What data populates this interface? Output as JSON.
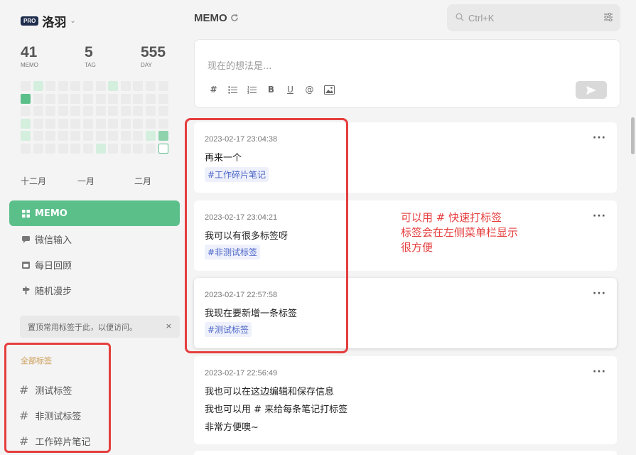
{
  "user": {
    "badge": "PRO",
    "name": "洛羽"
  },
  "stats": [
    {
      "value": "41",
      "label": "MEMO"
    },
    {
      "value": "5",
      "label": "TAG"
    },
    {
      "value": "555",
      "label": "DAY"
    }
  ],
  "heatmap_months": [
    "十二月",
    "一月",
    "二月"
  ],
  "nav": [
    {
      "label": "MEMO",
      "icon": "grid-icon",
      "active": true
    },
    {
      "label": "微信输入",
      "icon": "chat-icon"
    },
    {
      "label": "每日回顾",
      "icon": "calendar-icon"
    },
    {
      "label": "随机漫步",
      "icon": "signpost-icon"
    }
  ],
  "pin_hint": "置顶常用标签于此，以便访问。",
  "pin_close": "×",
  "tags_section": {
    "title": "全部标签",
    "items": [
      "测试标签",
      "非测试标签",
      "工作碎片笔记"
    ]
  },
  "page_title": "MEMO",
  "search": {
    "placeholder": "Ctrl+K"
  },
  "editor": {
    "placeholder": "现在的想法是...",
    "toolbar": [
      "#",
      "bullet-list-icon",
      "ordered-list-icon",
      "B",
      "U",
      "@",
      "image-icon"
    ]
  },
  "memos": [
    {
      "time": "2023-02-17 23:04:38",
      "lines": [
        "再来一个"
      ],
      "tag": "#工作碎片笔记"
    },
    {
      "time": "2023-02-17 23:04:21",
      "lines": [
        "我可以有很多标签呀"
      ],
      "tag": "#非测试标签"
    },
    {
      "time": "2023-02-17 22:57:58",
      "lines": [
        "我现在要新增一条标签"
      ],
      "tag": "#测试标签"
    },
    {
      "time": "2023-02-17 22:56:49",
      "lines": [
        "我也可以在这边编辑和保存信息",
        "我也可以用 # 来给每条笔记打标签",
        "非常方便噢~"
      ]
    }
  ],
  "annotation": [
    "可以用 # 快速打标签",
    "标签会在左侧菜单栏显示",
    "很方便"
  ],
  "colors": {
    "accent": "#5bbf8a",
    "annotation_red": "#e53e3e",
    "tag_blue": "#4a63c7"
  }
}
